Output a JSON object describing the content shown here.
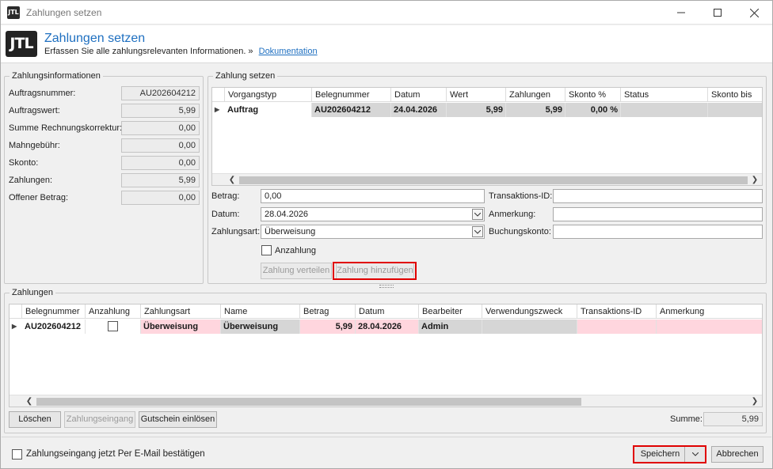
{
  "window": {
    "title": "Zahlungen setzen",
    "logo_text": "JTL",
    "header_title": "Zahlungen setzen",
    "header_subtitle": "Erfassen Sie alle zahlungsrelevanten Informationen. »",
    "doc_link": "Dokumentation"
  },
  "info": {
    "legend": "Zahlungsinformationen",
    "rows": [
      {
        "label": "Auftragsnummer:",
        "value": "AU202604212"
      },
      {
        "label": "Auftragswert:",
        "value": "5,99"
      },
      {
        "label": "Summe Rechnungskorrektur:",
        "value": "0,00"
      },
      {
        "label": "Mahngebühr:",
        "value": "0,00"
      },
      {
        "label": "Skonto:",
        "value": "0,00"
      },
      {
        "label": "Zahlungen:",
        "value": "5,99"
      },
      {
        "label": "Offener Betrag:",
        "value": "0,00"
      }
    ]
  },
  "set_payment": {
    "legend": "Zahlung setzen",
    "columns": [
      "Vorgangstyp",
      "Belegnummer",
      "Datum",
      "Wert",
      "Zahlungen",
      "Skonto %",
      "Status",
      "Skonto bis"
    ],
    "row": [
      "Auftrag",
      "AU202604212",
      "24.04.2026",
      "5,99",
      "5,99",
      "0,00 %",
      "",
      ""
    ],
    "form": {
      "betrag_label": "Betrag:",
      "betrag_value": "0,00",
      "datum_label": "Datum:",
      "datum_value": "28.04.2026",
      "art_label": "Zahlungsart:",
      "art_value": "Überweisung",
      "transaktion_label": "Transaktions-ID:",
      "transaktion_value": "",
      "anmerkung_label": "Anmerkung:",
      "anmerkung_value": "",
      "buchungskonto_label": "Buchungskonto:",
      "buchungskonto_value": "",
      "anzahlung_label": "Anzahlung"
    },
    "btn_verteilen": "Zahlung verteilen",
    "btn_hinzufuegen": "Zahlung hinzufügen"
  },
  "payments": {
    "legend": "Zahlungen",
    "columns": [
      "Belegnummer",
      "Anzahlung",
      "Zahlungsart",
      "Name",
      "Betrag",
      "Datum",
      "Bearbeiter",
      "Verwendungszweck",
      "Transaktions-ID",
      "Anmerkung"
    ],
    "row": {
      "belegnummer": "AU202604212",
      "zahlungsart": "Überweisung",
      "name": "Überweisung",
      "betrag": "5,99",
      "datum": "28.04.2026",
      "bearbeiter": "Admin"
    },
    "btn_loeschen": "Löschen",
    "btn_eingang": "Zahlungseingang",
    "btn_gutschein": "Gutschein einlösen",
    "summe_label": "Summe:",
    "summe_value": "5,99"
  },
  "footer": {
    "email_confirm": "Zahlungseingang jetzt Per E-Mail bestätigen",
    "save": "Speichern",
    "cancel": "Abbrechen"
  },
  "colors": {
    "accent": "#1e6fc0",
    "highlight_row": "#ffd6de",
    "red_frame": "#e00000"
  }
}
